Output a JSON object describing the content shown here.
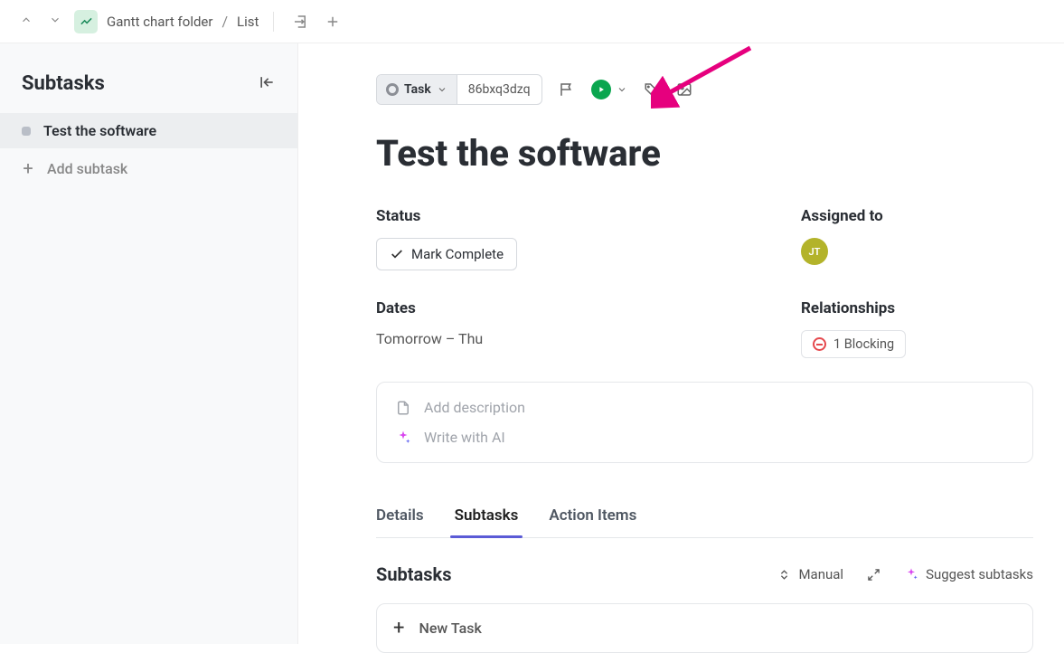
{
  "breadcrumb": {
    "folder": "Gantt chart folder",
    "view": "List"
  },
  "sidebar": {
    "title": "Subtasks",
    "items": [
      {
        "label": "Test the software"
      }
    ],
    "add_label": "Add subtask"
  },
  "task": {
    "type_label": "Task",
    "id": "86bxq3dzq",
    "title": "Test the software"
  },
  "fields": {
    "status_label": "Status",
    "mark_complete": "Mark Complete",
    "assigned_label": "Assigned to",
    "assignee_initials": "JT",
    "dates_label": "Dates",
    "dates_value": "Tomorrow – Thu",
    "relationships_label": "Relationships",
    "blocking_text": "1 Blocking"
  },
  "description": {
    "add_desc": "Add description",
    "write_ai": "Write with AI"
  },
  "tabs": {
    "details": "Details",
    "subtasks": "Subtasks",
    "action_items": "Action Items"
  },
  "subtasks_section": {
    "title": "Subtasks",
    "sort_label": "Manual",
    "suggest_label": "Suggest subtasks",
    "new_task": "New Task"
  }
}
